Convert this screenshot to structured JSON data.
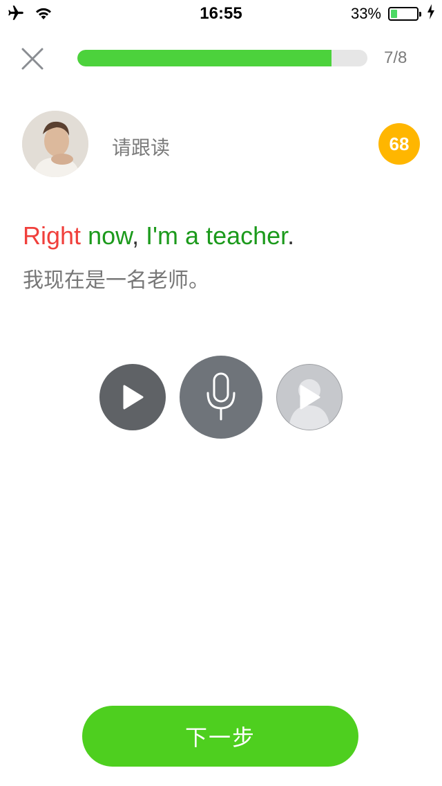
{
  "status_bar": {
    "time": "16:55",
    "battery_percent_text": "33%",
    "battery_level": 0.33,
    "icons": [
      "airplane-icon",
      "wifi-icon",
      "battery-icon",
      "charging-icon"
    ]
  },
  "header": {
    "close_icon": "close-icon",
    "progress": {
      "current": 7,
      "total": 8,
      "label": "7/8",
      "fraction": 0.875
    }
  },
  "teacher": {
    "avatar": "teacher-avatar",
    "prompt": "请跟读",
    "score": "68"
  },
  "sentence": {
    "words": [
      {
        "text": "Right",
        "status": "wrong"
      },
      {
        "text": " ",
        "status": "plain"
      },
      {
        "text": "now",
        "status": "correct"
      },
      {
        "text": ", ",
        "status": "plain"
      },
      {
        "text": "I'm",
        "status": "correct"
      },
      {
        "text": " ",
        "status": "plain"
      },
      {
        "text": "a",
        "status": "correct"
      },
      {
        "text": " ",
        "status": "plain"
      },
      {
        "text": "teacher",
        "status": "correct"
      },
      {
        "text": ".",
        "status": "plain"
      }
    ],
    "translation": "我现在是一名老师。"
  },
  "controls": {
    "play_icon": "play-icon",
    "mic_icon": "microphone-icon",
    "replay_icon": "play-recording-icon"
  },
  "next_button": {
    "label": "下一步"
  },
  "colors": {
    "accent_green": "#4ecf1f",
    "progress_green": "#4cd23c",
    "score_orange": "#ffb600",
    "word_wrong": "#f0403c",
    "word_correct": "#1c9a1c"
  }
}
